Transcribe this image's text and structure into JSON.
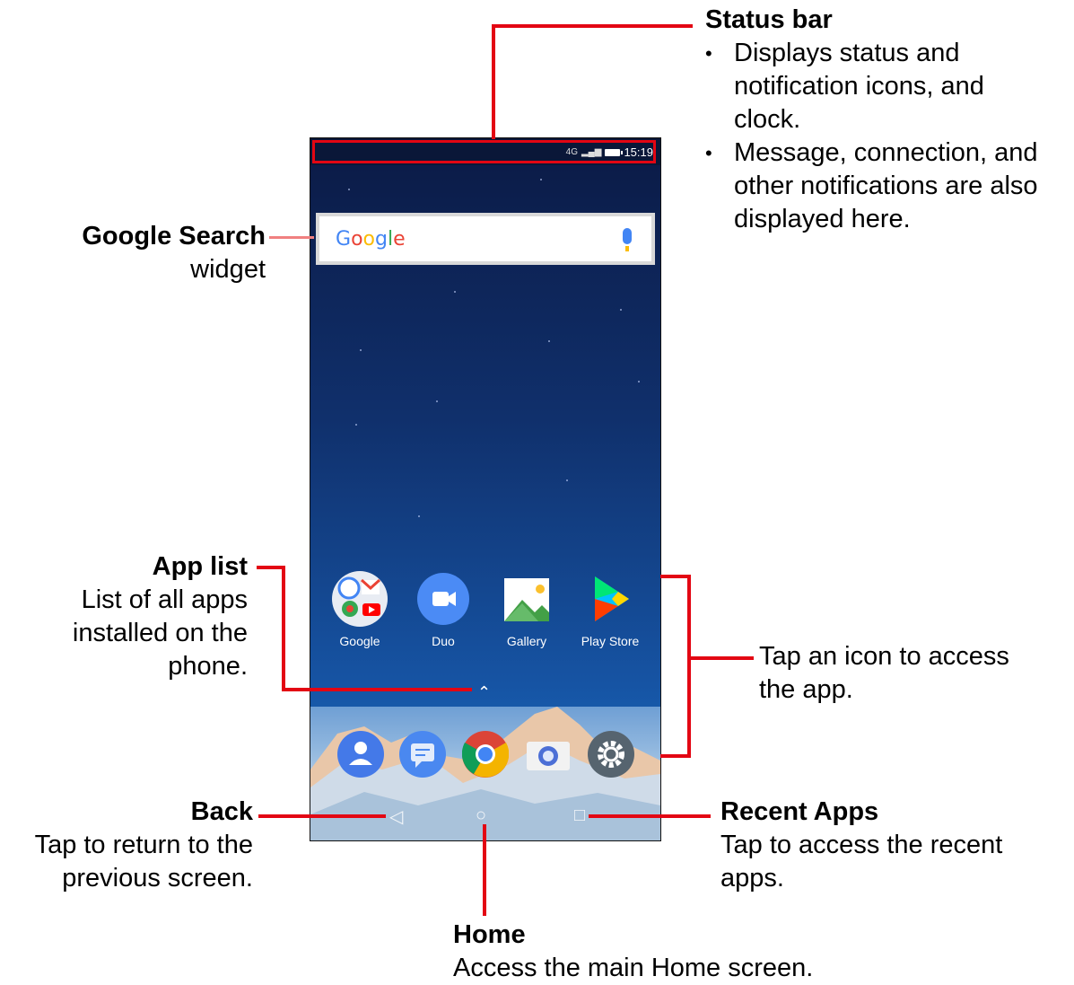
{
  "status_bar_callout": {
    "title": "Status bar",
    "bullets": [
      [
        "Displays status and",
        "notification icons, and",
        "clock."
      ],
      [
        "Message, connection, and",
        "other notifications are also",
        "displayed here."
      ]
    ]
  },
  "google_search_callout": {
    "title": "Google Search",
    "desc": "widget"
  },
  "app_list_callout": {
    "title": "App list",
    "desc": [
      "List of all apps",
      "installed on the",
      "phone."
    ]
  },
  "tap_icon_callout": {
    "desc": [
      "Tap an icon to access",
      "the app."
    ]
  },
  "back_callout": {
    "title": "Back",
    "desc": [
      "Tap to return to the",
      "previous screen."
    ]
  },
  "recent_callout": {
    "title": "Recent Apps",
    "desc": [
      "Tap to access the recent",
      "apps."
    ]
  },
  "home_callout": {
    "title": "Home",
    "desc": "Access the main Home screen."
  },
  "phone": {
    "status": {
      "network": "4G",
      "time": "15:19"
    },
    "search_logo": "Google",
    "apps": [
      "Google",
      "Duo",
      "Gallery",
      "Play Store"
    ],
    "dock_icons": [
      "contacts-icon",
      "messages-icon",
      "chrome-icon",
      "camera-icon",
      "settings-icon"
    ],
    "nav": [
      "back-icon",
      "home-icon",
      "recent-apps-icon"
    ]
  },
  "colors": {
    "callout_line": "#e30613",
    "wallpaper_top": "#0b1a45",
    "wallpaper_bottom": "#1e74c8"
  }
}
